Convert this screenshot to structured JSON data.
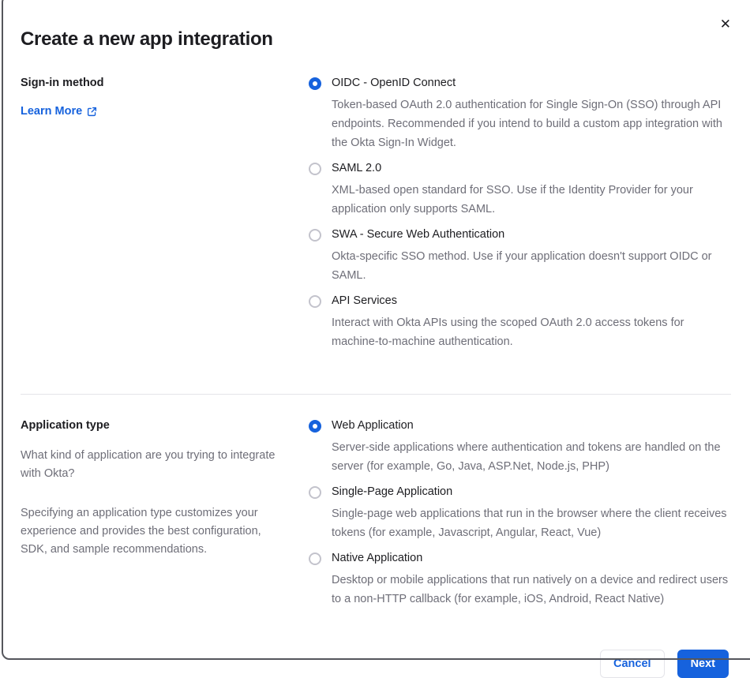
{
  "dialog": {
    "title": "Create a new app integration",
    "close_icon": "✕"
  },
  "signin_section": {
    "heading": "Sign-in method",
    "learn_more_label": "Learn More",
    "options": [
      {
        "label": "OIDC - OpenID Connect",
        "description": "Token-based OAuth 2.0 authentication for Single Sign-On (SSO) through API endpoints. Recommended if you intend to build a custom app integration with the Okta Sign-In Widget.",
        "selected": true
      },
      {
        "label": "SAML 2.0",
        "description": "XML-based open standard for SSO. Use if the Identity Provider for your application only supports SAML.",
        "selected": false
      },
      {
        "label": "SWA - Secure Web Authentication",
        "description": "Okta-specific SSO method. Use if your application doesn't support OIDC or SAML.",
        "selected": false
      },
      {
        "label": "API Services",
        "description": "Interact with Okta APIs using the scoped OAuth 2.0 access tokens for machine-to-machine authentication.",
        "selected": false
      }
    ]
  },
  "apptype_section": {
    "heading": "Application type",
    "paragraph1": "What kind of application are you trying to integrate with Okta?",
    "paragraph2": "Specifying an application type customizes your experience and provides the best configuration, SDK, and sample recommendations.",
    "options": [
      {
        "label": "Web Application",
        "description": "Server-side applications where authentication and tokens are handled on the server (for example, Go, Java, ASP.Net, Node.js, PHP)",
        "selected": true
      },
      {
        "label": "Single-Page Application",
        "description": "Single-page web applications that run in the browser where the client receives tokens (for example, Javascript, Angular, React, Vue)",
        "selected": false
      },
      {
        "label": "Native Application",
        "description": "Desktop or mobile applications that run natively on a device and redirect users to a non-HTTP callback (for example, iOS, Android, React Native)",
        "selected": false
      }
    ]
  },
  "footer": {
    "cancel_label": "Cancel",
    "next_label": "Next"
  },
  "colors": {
    "accent_blue": "#1662dd",
    "text_dark": "#1d1d21",
    "text_gray": "#6e6e78",
    "divider": "#e4e4e9"
  }
}
